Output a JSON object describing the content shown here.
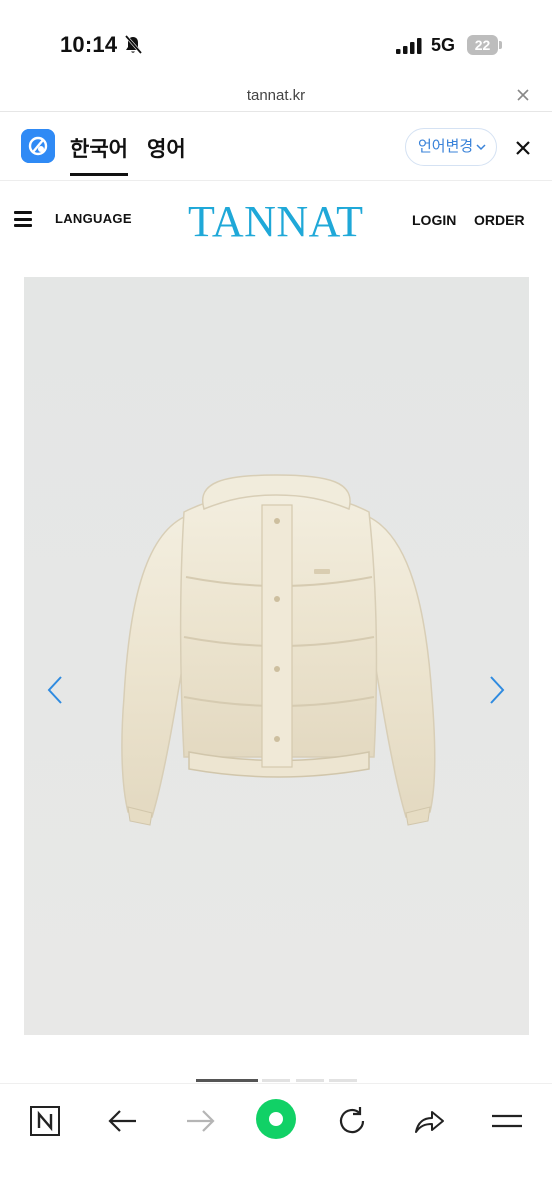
{
  "status_bar": {
    "time": "10:14",
    "network": "5G",
    "battery": "22",
    "icons": [
      "bell-slash-icon",
      "signal-icon",
      "battery-icon"
    ]
  },
  "browser": {
    "url": "tannat.kr"
  },
  "translate_bar": {
    "tabs": [
      "한국어",
      "영어"
    ],
    "change_language_label": "언어변경",
    "accent_color": "#2f8af5"
  },
  "site_header": {
    "language_label": "LANGUAGE",
    "brand": "TANNAT",
    "brand_color": "#1fa8d8",
    "login_label": "LOGIN",
    "order_label": "ORDER"
  },
  "carousel": {
    "image_subject": "cream hooded puffer jacket",
    "slide_count": 4,
    "active_slide": 1
  },
  "toolbar": {
    "icons": [
      "naver-home-icon",
      "back-arrow-icon",
      "forward-arrow-icon",
      "green-dot-icon",
      "refresh-icon",
      "share-icon",
      "menu-icon"
    ],
    "green_color": "#11d166"
  }
}
